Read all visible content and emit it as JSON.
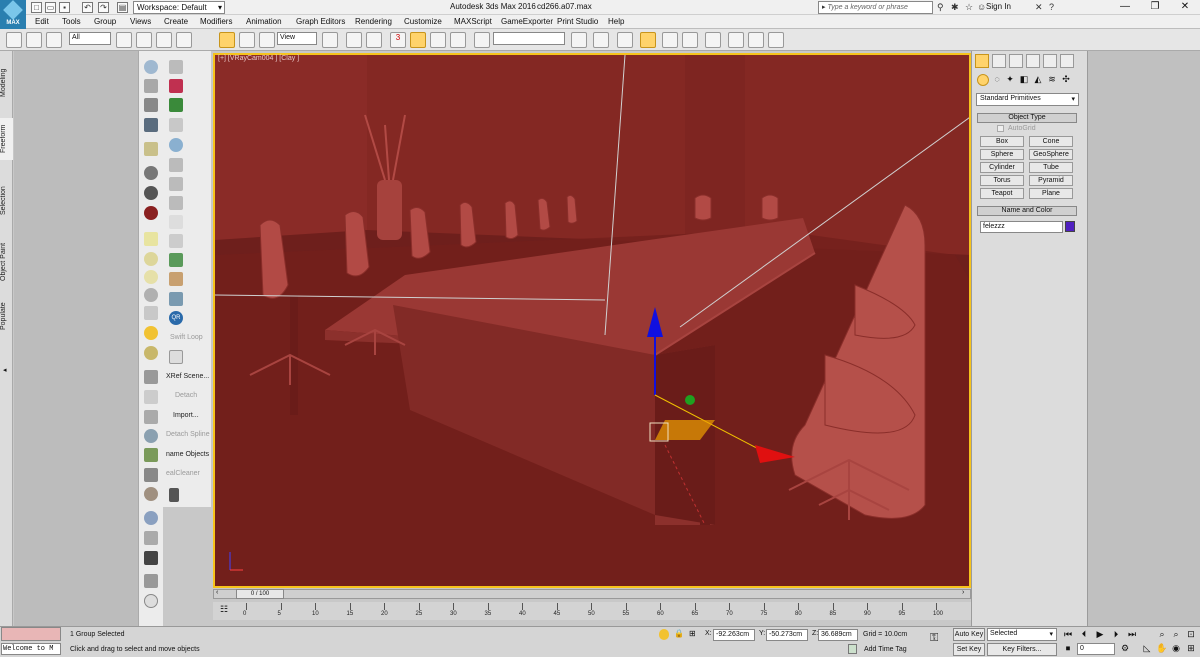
{
  "titlebar": {
    "logo_text": "MAX",
    "workspace": "Workspace: Default",
    "app_title": "Autodesk 3ds Max 2016",
    "file_title": "cd266.a07.max",
    "search_placeholder": "Type a keyword or phrase",
    "sign_in": "Sign In",
    "minimize": "—",
    "restore": "❐",
    "close": "✕"
  },
  "menu": [
    "Edit",
    "Tools",
    "Group",
    "Views",
    "Create",
    "Modifiers",
    "Animation",
    "Graph Editors",
    "Rendering",
    "Customize",
    "MAXScript",
    "GameExporter",
    "Print Studio",
    "Help"
  ],
  "toolbar": {
    "selection_filter": "All",
    "ref_coord": "View",
    "snap_label": "3"
  },
  "left_tabs": [
    "Modeling",
    "Freeform",
    "Selection",
    "Object Paint",
    "Populate"
  ],
  "tool_labels": [
    "Swift Loop",
    "XRef Scene...",
    "Detach",
    "Import...",
    "Detach Spline",
    "name Objects",
    "ealCleaner"
  ],
  "viewport": {
    "label": "[+] [VRayCam004 ] [Clay ]",
    "background": "#7a2420",
    "border_color": "#f6c31c"
  },
  "command_panel": {
    "category": "Standard Primitives",
    "object_type_header": "Object Type",
    "autogrid": "AutoGrid",
    "buttons": [
      "Box",
      "Cone",
      "Sphere",
      "GeoSphere",
      "Cylinder",
      "Tube",
      "Torus",
      "Pyramid",
      "Teapot",
      "Plane"
    ],
    "name_color_header": "Name and Color",
    "object_name": "felezzz",
    "object_color": "#5020c0"
  },
  "timeline": {
    "frame": "0 / 100",
    "ticks": [
      "0",
      "5",
      "10",
      "15",
      "20",
      "25",
      "30",
      "35",
      "40",
      "45",
      "50",
      "55",
      "60",
      "65",
      "70",
      "75",
      "80",
      "85",
      "90",
      "95",
      "100"
    ]
  },
  "status": {
    "listener": "Welcome to M",
    "selection_msg": "1 Group Selected",
    "prompt_msg": "Click and drag to select and move objects",
    "x_label": "X:",
    "x_value": "-92.263cm",
    "y_label": "Y:",
    "y_value": "-50.273cm",
    "z_label": "Z:",
    "z_value": "36.689cm",
    "grid": "Grid = 10.0cm",
    "add_time_tag": "Add Time Tag",
    "auto_key": "Auto Key",
    "set_key": "Set Key",
    "selected_set": "Selected",
    "key_filters": "Key Filters...",
    "current_frame": "0"
  }
}
